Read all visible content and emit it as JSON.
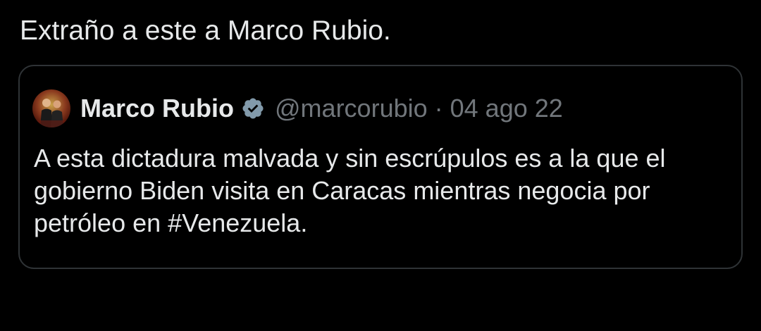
{
  "tweet": {
    "text": "Extraño a este a Marco Rubio."
  },
  "quote": {
    "author_name": "Marco Rubio",
    "handle": "@marcorubio",
    "separator": "·",
    "date": "04 ago 22",
    "verified_icon": "verified-badge-icon",
    "body": "A esta dictadura malvada y sin escrúpulos es a la que el gobierno Biden visita en Caracas mientras negocia por petróleo en #Venezuela."
  },
  "colors": {
    "background": "#000000",
    "text_primary": "#e7e9ea",
    "text_secondary": "#71767b",
    "card_border": "#2f3336"
  }
}
